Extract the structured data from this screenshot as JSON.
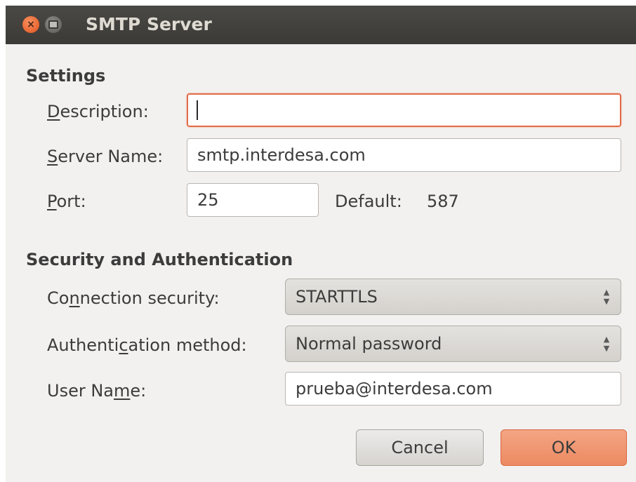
{
  "window": {
    "title": "SMTP Server",
    "close_glyph": "×"
  },
  "settings": {
    "heading": "Settings",
    "description": {
      "mnemonic": "D",
      "rest": "escription:",
      "value": ""
    },
    "server_name": {
      "mnemonic": "S",
      "rest": "erver Name:",
      "value": "smtp.interdesa.com"
    },
    "port": {
      "mnemonic": "P",
      "rest": "ort:",
      "value": "25"
    },
    "default_label": "Default:",
    "default_value": "587"
  },
  "security": {
    "heading": "Security and Authentication",
    "connection": {
      "pre": "Co",
      "mnemonic": "n",
      "rest": "nection security:",
      "value": "STARTTLS"
    },
    "auth": {
      "pre": "Authenti",
      "mnemonic": "c",
      "rest": "ation method:",
      "value": "Normal password"
    },
    "user": {
      "pre": "User Na",
      "mnemonic": "m",
      "rest": "e:",
      "value": "prueba@interdesa.com"
    }
  },
  "buttons": {
    "cancel": "Cancel",
    "ok": "OK"
  },
  "icons": {
    "close": "close-icon",
    "minimize": "minimize-icon",
    "spinner": "up-down-arrows-icon"
  },
  "colors": {
    "accent": "#e26c49",
    "ok_button": "#ec8a62",
    "titlebar": "#3b3a37"
  }
}
